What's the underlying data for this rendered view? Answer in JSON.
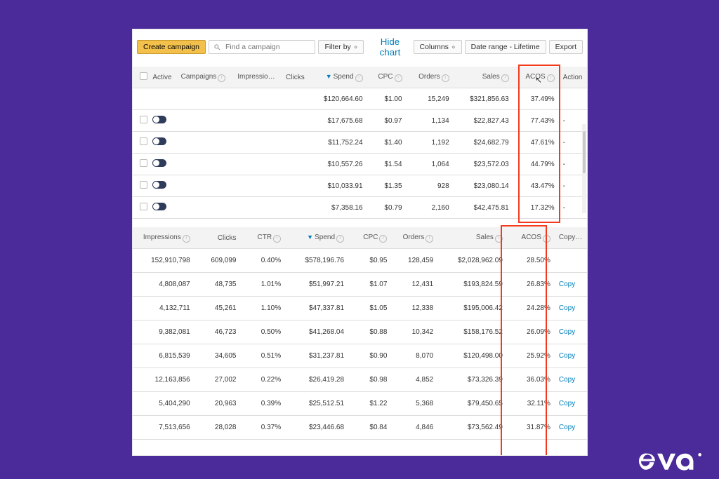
{
  "toolbar": {
    "create": "Create campaign",
    "search_placeholder": "Find a campaign",
    "filter": "Filter by",
    "hide_chart": "Hide chart",
    "columns": "Columns",
    "date_range": "Date range - Lifetime",
    "export": "Export"
  },
  "upper": {
    "cols": {
      "active": "Active",
      "campaigns": "Campaigns",
      "impressions": "Impressions",
      "clicks": "Clicks",
      "spend": "Spend",
      "cpc": "CPC",
      "orders": "Orders",
      "sales": "Sales",
      "acos": "ACOS",
      "action": "Action"
    },
    "rows": [
      {
        "total": true,
        "spend": "$120,664.60",
        "cpc": "$1.00",
        "orders": "15,249",
        "sales": "$321,856.63",
        "acos": "37.49%",
        "action": ""
      },
      {
        "spend": "$17,675.68",
        "cpc": "$0.97",
        "orders": "1,134",
        "sales": "$22,827.43",
        "acos": "77.43%",
        "action": "-"
      },
      {
        "spend": "$11,752.24",
        "cpc": "$1.40",
        "orders": "1,192",
        "sales": "$24,682.79",
        "acos": "47.61%",
        "action": "-"
      },
      {
        "spend": "$10,557.26",
        "cpc": "$1.54",
        "orders": "1,064",
        "sales": "$23,572.03",
        "acos": "44.79%",
        "action": "-"
      },
      {
        "spend": "$10,033.91",
        "cpc": "$1.35",
        "orders": "928",
        "sales": "$23,080.14",
        "acos": "43.47%",
        "action": "-"
      },
      {
        "spend": "$7,358.16",
        "cpc": "$0.79",
        "orders": "2,160",
        "sales": "$42,475.81",
        "acos": "17.32%",
        "action": "-"
      }
    ]
  },
  "lower": {
    "cols": {
      "impressions": "Impressions",
      "clicks": "Clicks",
      "ctr": "CTR",
      "spend": "Spend",
      "cpc": "CPC",
      "orders": "Orders",
      "sales": "Sales",
      "acos": "ACOS",
      "copy": "Copy"
    },
    "rows": [
      {
        "impressions": "152,910,798",
        "clicks": "609,099",
        "ctr": "0.40%",
        "spend": "$578,196.76",
        "cpc": "$0.95",
        "orders": "128,459",
        "sales": "$2,028,962.09",
        "acos": "28.50%",
        "copy": ""
      },
      {
        "impressions": "4,808,087",
        "clicks": "48,735",
        "ctr": "1.01%",
        "spend": "$51,997.21",
        "cpc": "$1.07",
        "orders": "12,431",
        "sales": "$193,824.59",
        "acos": "26.83%",
        "copy": "Copy"
      },
      {
        "impressions": "4,132,711",
        "clicks": "45,261",
        "ctr": "1.10%",
        "spend": "$47,337.81",
        "cpc": "$1.05",
        "orders": "12,338",
        "sales": "$195,006.42",
        "acos": "24.28%",
        "copy": "Copy"
      },
      {
        "impressions": "9,382,081",
        "clicks": "46,723",
        "ctr": "0.50%",
        "spend": "$41,268.04",
        "cpc": "$0.88",
        "orders": "10,342",
        "sales": "$158,176.52",
        "acos": "26.09%",
        "copy": "Copy"
      },
      {
        "impressions": "6,815,539",
        "clicks": "34,605",
        "ctr": "0.51%",
        "spend": "$31,237.81",
        "cpc": "$0.90",
        "orders": "8,070",
        "sales": "$120,498.00",
        "acos": "25.92%",
        "copy": "Copy"
      },
      {
        "impressions": "12,163,856",
        "clicks": "27,002",
        "ctr": "0.22%",
        "spend": "$26,419.28",
        "cpc": "$0.98",
        "orders": "4,852",
        "sales": "$73,326.39",
        "acos": "36.03%",
        "copy": "Copy"
      },
      {
        "impressions": "5,404,290",
        "clicks": "20,963",
        "ctr": "0.39%",
        "spend": "$25,512.51",
        "cpc": "$1.22",
        "orders": "5,368",
        "sales": "$79,450.65",
        "acos": "32.11%",
        "copy": "Copy"
      },
      {
        "impressions": "7,513,656",
        "clicks": "28,028",
        "ctr": "0.37%",
        "spend": "$23,446.68",
        "cpc": "$0.84",
        "orders": "4,846",
        "sales": "$73,562.49",
        "acos": "31.87%",
        "copy": "Copy"
      }
    ]
  },
  "logo": "eva"
}
